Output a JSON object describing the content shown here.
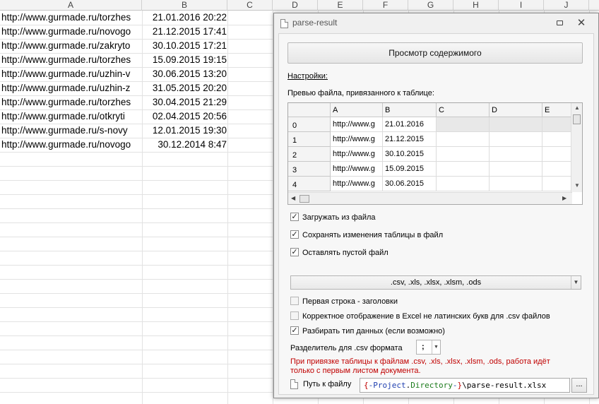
{
  "sheet": {
    "columns": [
      "A",
      "B",
      "C",
      "D",
      "E",
      "F",
      "G",
      "H",
      "I",
      "J"
    ],
    "rows": [
      {
        "url": "http://www.gurmade.ru/torzhes",
        "date": "21.01.2016 20:22"
      },
      {
        "url": "http://www.gurmade.ru/novogo",
        "date": "21.12.2015 17:41"
      },
      {
        "url": "http://www.gurmade.ru/zakryto",
        "date": "30.10.2015 17:21"
      },
      {
        "url": "http://www.gurmade.ru/torzhes",
        "date": "15.09.2015 19:15"
      },
      {
        "url": "http://www.gurmade.ru/uzhin-v",
        "date": "30.06.2015 13:20"
      },
      {
        "url": "http://www.gurmade.ru/uzhin-z",
        "date": "31.05.2015 20:20"
      },
      {
        "url": "http://www.gurmade.ru/torzhes",
        "date": "30.04.2015 21:29"
      },
      {
        "url": "http://www.gurmade.ru/otkryti",
        "date": "02.04.2015 20:56"
      },
      {
        "url": "http://www.gurmade.ru/s-novy",
        "date": "12.01.2015 19:30"
      },
      {
        "url": "http://www.gurmade.ru/novogo",
        "date": "30.12.2014 8:47"
      }
    ]
  },
  "dialog": {
    "title": "parse-result",
    "view_button": "Просмотр содержимого",
    "settings_link": "Настройки:",
    "preview_label": "Превью файла, привязанного к таблице:",
    "preview": {
      "headers": [
        "A",
        "B",
        "C",
        "D",
        "E"
      ],
      "rows": [
        {
          "num": "0",
          "a": "http://www.g",
          "b": "21.01.2016"
        },
        {
          "num": "1",
          "a": "http://www.g",
          "b": "21.12.2015"
        },
        {
          "num": "2",
          "a": "http://www.g",
          "b": "30.10.2015"
        },
        {
          "num": "3",
          "a": "http://www.g",
          "b": "15.09.2015"
        },
        {
          "num": "4",
          "a": "http://www.g",
          "b": "30.06.2015"
        }
      ]
    },
    "options": {
      "load_from_file": {
        "label": "Загружать из файла",
        "checked": true
      },
      "save_changes": {
        "label": "Сохранять изменения таблицы в файл",
        "checked": true
      },
      "keep_empty": {
        "label": "Оставлять пустой файл",
        "checked": true
      },
      "first_row_headers": {
        "label": "Первая строка - заголовки",
        "checked": false
      },
      "excel_display": {
        "label": "Корректное отображение в Excel не латинских букв для .csv файлов",
        "checked": false
      },
      "parse_types": {
        "label": "Разбирать тип данных (если возможно)",
        "checked": true
      }
    },
    "formats_combo": ".csv, .xls, .xlsx, .xlsm, .ods",
    "separator_label": "Разделитель для .csv формата",
    "separator_value": ";",
    "warning": "При привязке таблицы к файлам .csv, .xls, .xlsx, .xlsm, .ods, работа идёт только с первым листом документа.",
    "path_label": "Путь к файлу",
    "path": {
      "brace_open": "{",
      "minus1": "-",
      "project": "Project",
      "dot": ".",
      "directory": "Directory",
      "minus2": "-",
      "brace_close": "}",
      "rest": "\\parse-result.xlsx"
    },
    "browse_button": "..."
  }
}
